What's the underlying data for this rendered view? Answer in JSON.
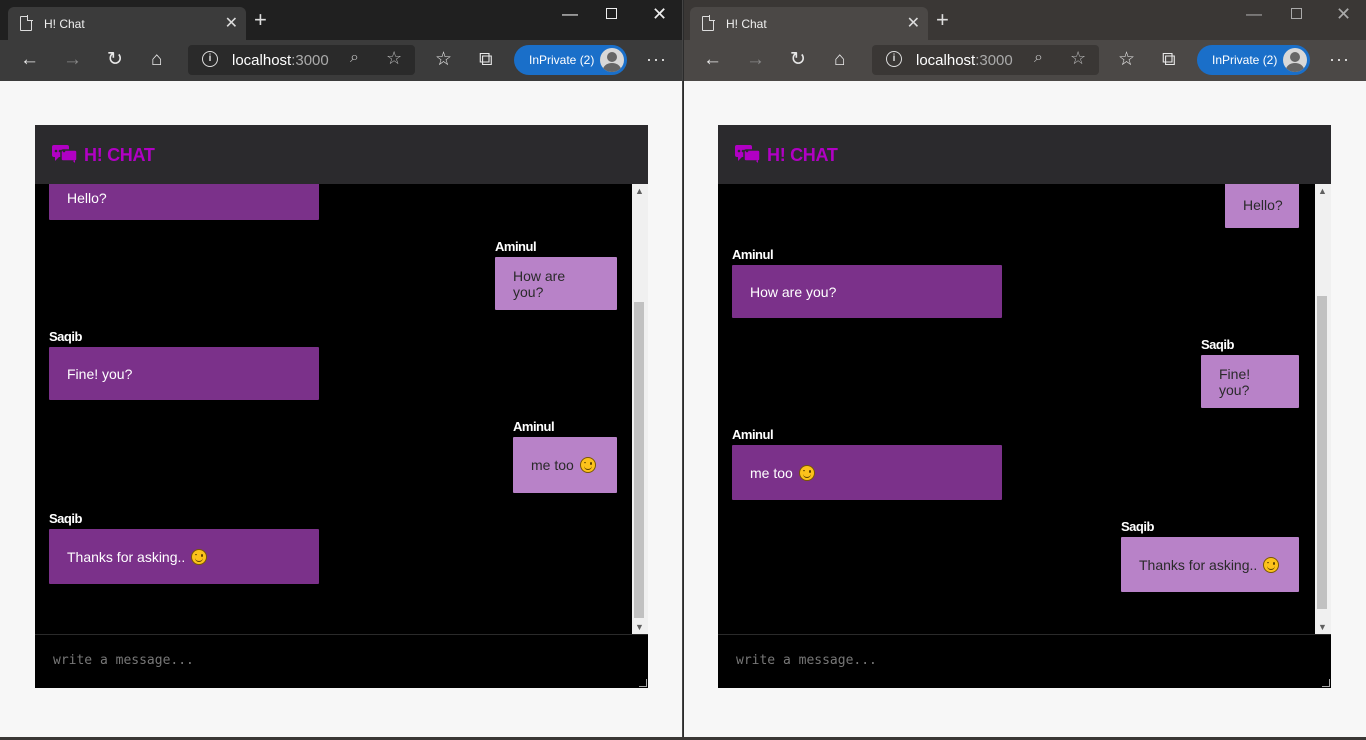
{
  "windows": {
    "left": {
      "tab": {
        "title": "H! Chat",
        "close": "✕",
        "new_tab": "+"
      },
      "window_controls": {
        "minimize": "—",
        "close": "✕"
      },
      "toolbar": {
        "back": "←",
        "forward": "→",
        "refresh": "↻",
        "home": "⌂",
        "address_host": "localhost",
        "address_port": ":3000",
        "zoom": "⌕",
        "favorite": "☆",
        "favorites_list": "☆",
        "collections": "⧉",
        "inprivate_label": "InPrivate (2)",
        "more": "···"
      },
      "app": {
        "title": "H! CHAT",
        "messages": [
          {
            "sender": "",
            "text": "Hello?",
            "emoji": false
          },
          {
            "sender": "Aminul",
            "text": "How are you?",
            "emoji": false
          },
          {
            "sender": "Saqib",
            "text": "Fine! you?",
            "emoji": false
          },
          {
            "sender": "Aminul",
            "text": "me too",
            "emoji": true
          },
          {
            "sender": "Saqib",
            "text": "Thanks for asking..",
            "emoji": true
          }
        ],
        "composer_placeholder": "write a message..."
      }
    },
    "right": {
      "tab": {
        "title": "H! Chat",
        "close": "✕",
        "new_tab": "+"
      },
      "window_controls": {
        "minimize": "—",
        "close": "✕"
      },
      "toolbar": {
        "back": "←",
        "forward": "→",
        "refresh": "↻",
        "home": "⌂",
        "address_host": "localhost",
        "address_port": ":3000",
        "zoom": "⌕",
        "favorite": "☆",
        "favorites_list": "☆",
        "collections": "⧉",
        "inprivate_label": "InPrivate (2)",
        "more": "···"
      },
      "app": {
        "title": "H! CHAT",
        "messages": [
          {
            "sender": "",
            "text": "Hello?",
            "emoji": false
          },
          {
            "sender": "Aminul",
            "text": "How are you?",
            "emoji": false
          },
          {
            "sender": "Saqib",
            "text": "Fine! you?",
            "emoji": false
          },
          {
            "sender": "Aminul",
            "text": "me too",
            "emoji": true
          },
          {
            "sender": "Saqib",
            "text": "Thanks for asking..",
            "emoji": true
          }
        ],
        "composer_placeholder": "write a message..."
      }
    }
  },
  "colors": {
    "brand": "#b100c4",
    "bubble_dark": "#7b318a",
    "bubble_light": "#b882c8",
    "inprivate": "#1a6fc9"
  },
  "icons": {
    "tab": "page-icon",
    "logo": "chat-bubbles-icon",
    "address": "info-icon"
  }
}
